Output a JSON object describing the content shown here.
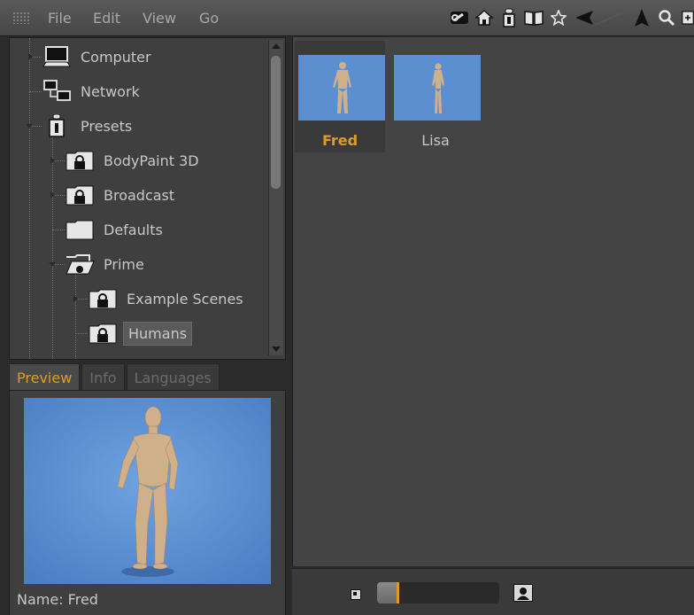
{
  "menu": {
    "file": "File",
    "edit": "Edit",
    "view": "View",
    "go": "Go"
  },
  "toolbar_icons": [
    "link-icon",
    "home-icon",
    "presets-icon",
    "book-icon",
    "star-icon",
    "back-arrow-icon",
    "up-arrow-icon",
    "search-icon",
    "add-icon"
  ],
  "tree": {
    "items": [
      {
        "label": "Computer"
      },
      {
        "label": "Network"
      },
      {
        "label": "Presets"
      },
      {
        "label": "BodyPaint 3D"
      },
      {
        "label": "Broadcast"
      },
      {
        "label": "Defaults"
      },
      {
        "label": "Prime"
      },
      {
        "label": "Example Scenes"
      },
      {
        "label": "Humans"
      }
    ]
  },
  "tabs": {
    "preview": "Preview",
    "info": "Info",
    "languages": "Languages"
  },
  "preview": {
    "name_line": "Name: Fred"
  },
  "content": {
    "items": [
      {
        "name": "Fred"
      },
      {
        "name": "Lisa"
      }
    ]
  },
  "statusbar": {
    "zoom_fraction": 0.16
  },
  "colors": {
    "accent": "#e09a2a",
    "sky": "#5c8fd0"
  }
}
